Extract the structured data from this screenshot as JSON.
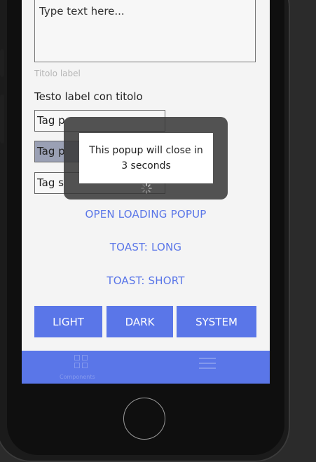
{
  "input": {
    "placeholder": "Type text here..."
  },
  "labels": {
    "title": "Titolo label",
    "text": "Testo label con titolo"
  },
  "tags": [
    "Tag p",
    "Tag p",
    "Tag s"
  ],
  "buttons": {
    "open_loading_popup": "OPEN LOADING POPUP",
    "toast_long": "TOAST: LONG",
    "toast_short": "TOAST: SHORT"
  },
  "modes": [
    "LIGHT",
    "DARK",
    "SYSTEM"
  ],
  "tabbar": {
    "first_tab_label": "Components"
  },
  "popup": {
    "line1": "This popup will close in",
    "line2": "3 seconds"
  },
  "colors": {
    "accent": "#5a76e8",
    "popup_bg": "#373737",
    "selected_tag": "#9aa0b4"
  }
}
